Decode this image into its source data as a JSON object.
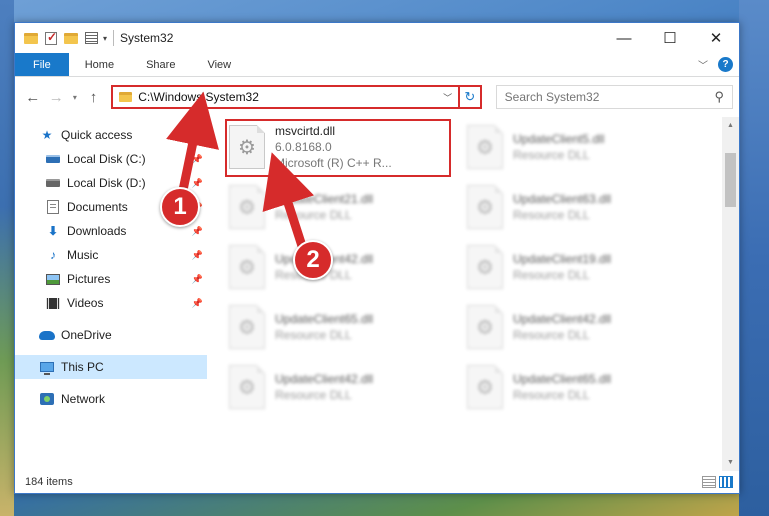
{
  "window": {
    "title": "System32",
    "controls": {
      "minimize": "—",
      "maximize": "☐",
      "close": "✕"
    }
  },
  "ribbon": {
    "tabs": [
      {
        "label": "File"
      },
      {
        "label": "Home"
      },
      {
        "label": "Share"
      },
      {
        "label": "View"
      }
    ],
    "expand_icon": "chevron-down-icon",
    "help": "?"
  },
  "address": {
    "path": "C:\\Windows\\System32",
    "search_placeholder": "Search System32"
  },
  "navpane": {
    "quick_access": "Quick access",
    "pinned": [
      {
        "label": "Local Disk (C:)",
        "icon": "drive-icon"
      },
      {
        "label": "Local Disk (D:)",
        "icon": "drive-icon"
      },
      {
        "label": "Documents",
        "icon": "documents-icon"
      },
      {
        "label": "Downloads",
        "icon": "downloads-icon"
      },
      {
        "label": "Music",
        "icon": "music-icon"
      },
      {
        "label": "Pictures",
        "icon": "pictures-icon"
      },
      {
        "label": "Videos",
        "icon": "videos-icon"
      }
    ],
    "onedrive": "OneDrive",
    "this_pc": "This PC",
    "network": "Network"
  },
  "files": {
    "highlighted": {
      "name": "msvcirtd.dll",
      "version": "6.0.8168.0",
      "company": "Microsoft (R) C++ R..."
    },
    "left_column": [
      {
        "name": "UpdateClient21.dll",
        "desc": "Resource DLL"
      },
      {
        "name": "UpdateClient42.dll",
        "desc": "Resource DLL"
      },
      {
        "name": "UpdateClient65.dll",
        "desc": "Resource DLL"
      },
      {
        "name": "UpdateClient42.dll",
        "desc": "Resource DLL"
      }
    ],
    "right_column": [
      {
        "name": "UpdateClient5.dll",
        "desc": "Resource DLL"
      },
      {
        "name": "UpdateClient63.dll",
        "desc": "Resource DLL"
      },
      {
        "name": "UpdateClient19.dll",
        "desc": "Resource DLL"
      },
      {
        "name": "UpdateClient42.dll",
        "desc": "Resource DLL"
      },
      {
        "name": "UpdateClient65.dll",
        "desc": "Resource DLL"
      }
    ]
  },
  "status": {
    "items": "184 items"
  },
  "callouts": {
    "first": "1",
    "second": "2"
  },
  "colors": {
    "accent": "#1979ca",
    "highlight": "#d62b2b",
    "selected": "#cce8ff"
  }
}
